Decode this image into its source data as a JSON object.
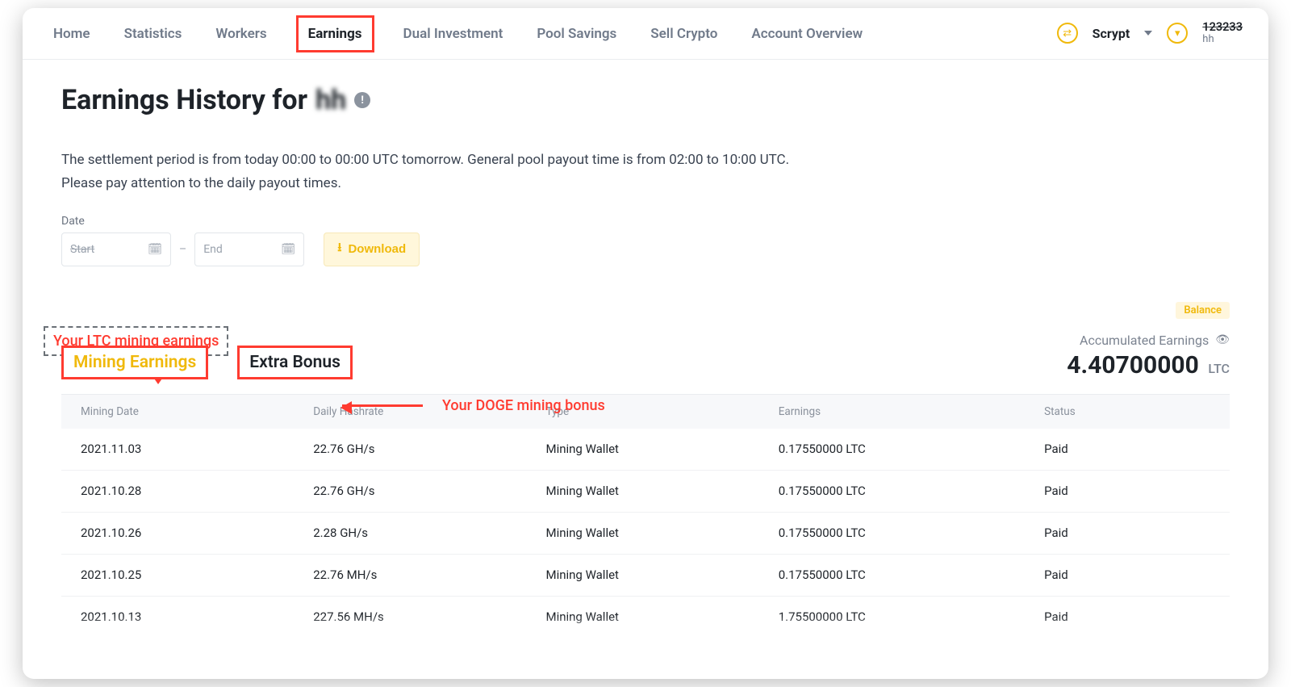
{
  "nav": {
    "items": [
      {
        "label": "Home",
        "active": false
      },
      {
        "label": "Statistics",
        "active": false
      },
      {
        "label": "Workers",
        "active": false
      },
      {
        "label": "Earnings",
        "active": true
      },
      {
        "label": "Dual Investment",
        "active": false
      },
      {
        "label": "Pool Savings",
        "active": false
      },
      {
        "label": "Sell Crypto",
        "active": false
      },
      {
        "label": "Account Overview",
        "active": false
      }
    ],
    "algo": "Scrypt",
    "user_top": "123233",
    "user_sub": "hh"
  },
  "page": {
    "title_prefix": "Earnings History for ",
    "title_user": "hh",
    "desc_line1": "The settlement period is from today 00:00 to 00:00 UTC tomorrow. General pool payout time is from 02:00 to 10:00 UTC.",
    "desc_line2": "Please pay attention to the daily payout times."
  },
  "date": {
    "label": "Date",
    "start_placeholder": "Start",
    "end_placeholder": "End",
    "download": "Download"
  },
  "annotations": {
    "ltc": "Your LTC mining earnings",
    "doge": "Your DOGE mining bonus"
  },
  "tabs": {
    "mining": "Mining Earnings",
    "bonus": "Extra Bonus"
  },
  "summary": {
    "balance_badge": "Balance",
    "acc_label": "Accumulated Earnings",
    "acc_value": "4.40700000",
    "acc_unit": "LTC"
  },
  "table": {
    "headers": [
      "Mining Date",
      "Daily Hashrate",
      "Type",
      "Earnings",
      "Status"
    ],
    "rows": [
      {
        "date": "2021.11.03",
        "hash": "22.76 GH/s",
        "type": "Mining Wallet",
        "earn": "0.17550000 LTC",
        "status": "Paid"
      },
      {
        "date": "2021.10.28",
        "hash": "22.76 GH/s",
        "type": "Mining Wallet",
        "earn": "0.17550000 LTC",
        "status": "Paid"
      },
      {
        "date": "2021.10.26",
        "hash": "2.28 GH/s",
        "type": "Mining Wallet",
        "earn": "0.17550000 LTC",
        "status": "Paid"
      },
      {
        "date": "2021.10.25",
        "hash": "22.76 MH/s",
        "type": "Mining Wallet",
        "earn": "0.17550000 LTC",
        "status": "Paid"
      },
      {
        "date": "2021.10.13",
        "hash": "227.56 MH/s",
        "type": "Mining Wallet",
        "earn": "1.75500000 LTC",
        "status": "Paid"
      }
    ]
  }
}
